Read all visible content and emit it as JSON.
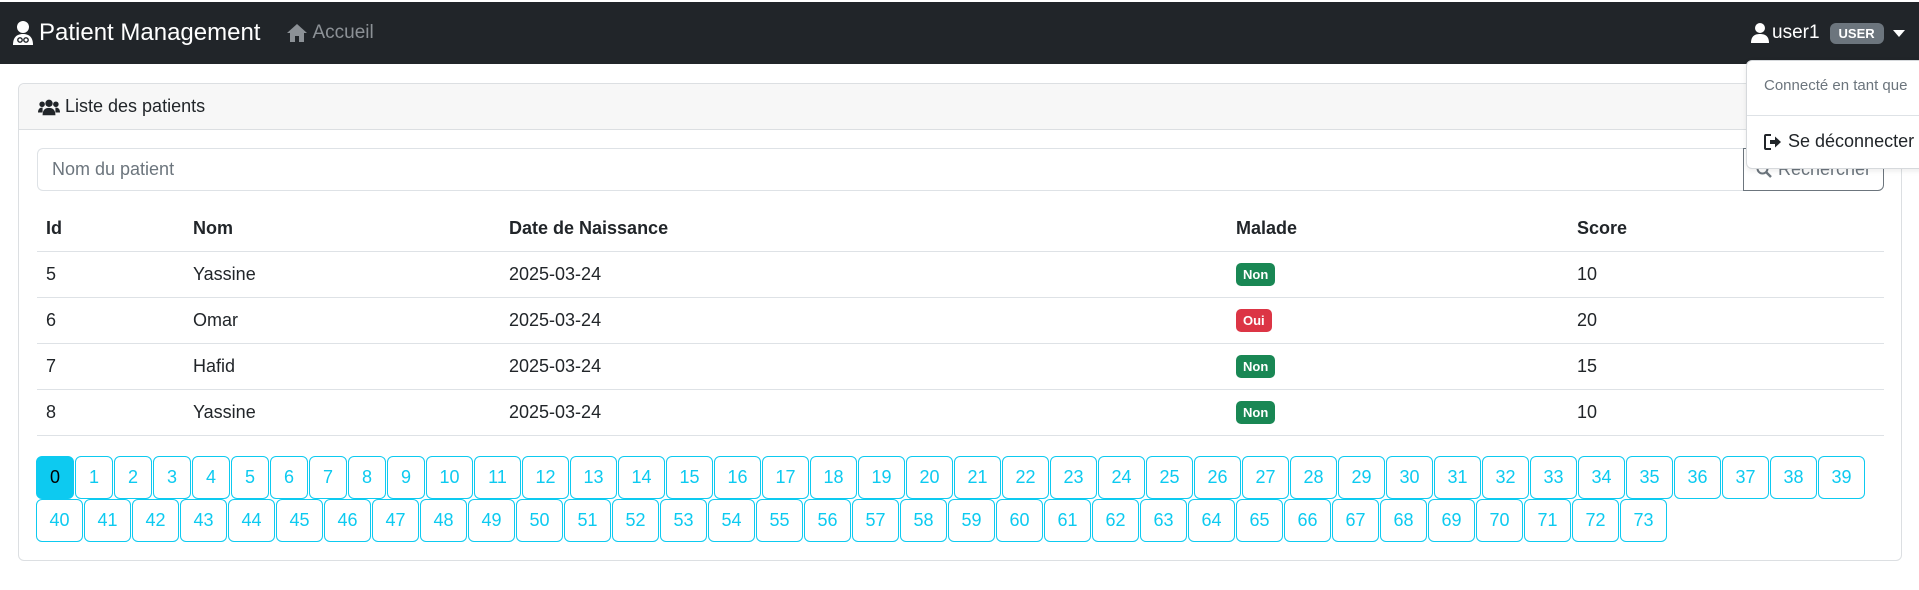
{
  "navbar": {
    "brand": "Patient Management",
    "home_link": "Accueil",
    "username": "user1",
    "role_badge": "USER",
    "bg_color": "#212529"
  },
  "user_menu": {
    "header": "Connecté en tant que",
    "logout": "Se déconnecter"
  },
  "card": {
    "title": "Liste des patients"
  },
  "search": {
    "placeholder": "Nom du patient",
    "button": "Rechercher"
  },
  "table": {
    "columns": [
      "Id",
      "Nom",
      "Date de Naissance",
      "Malade",
      "Score"
    ],
    "rows": [
      {
        "id": "5",
        "nom": "Yassine",
        "date": "2025-03-24",
        "malade": "Non",
        "score": "10"
      },
      {
        "id": "6",
        "nom": "Omar",
        "date": "2025-03-24",
        "malade": "Oui",
        "score": "20"
      },
      {
        "id": "7",
        "nom": "Hafid",
        "date": "2025-03-24",
        "malade": "Non",
        "score": "15"
      },
      {
        "id": "8",
        "nom": "Yassine",
        "date": "2025-03-24",
        "malade": "Non",
        "score": "10"
      }
    ]
  },
  "pagination": {
    "current_page": "0",
    "pages": [
      "0",
      "1",
      "2",
      "3",
      "4",
      "5",
      "6",
      "7",
      "8",
      "9",
      "10",
      "11",
      "12",
      "13",
      "14",
      "15",
      "16",
      "17",
      "18",
      "19",
      "20",
      "21",
      "22",
      "23",
      "24",
      "25",
      "26",
      "27",
      "28",
      "29",
      "30",
      "31",
      "32",
      "33",
      "34",
      "35",
      "36",
      "37",
      "38",
      "39",
      "40",
      "41",
      "42",
      "43",
      "44",
      "45",
      "46",
      "47",
      "48",
      "49",
      "50",
      "51",
      "52",
      "53",
      "54",
      "55",
      "56",
      "57",
      "58",
      "59",
      "60",
      "61",
      "62",
      "63",
      "64",
      "65",
      "66",
      "67",
      "68",
      "69",
      "70",
      "71",
      "72",
      "73"
    ]
  },
  "colors": {
    "accent_info": "#0dcaf0",
    "badge_non": "#198754",
    "badge_oui": "#dc3545",
    "role_badge": "#6c757d"
  },
  "icons": {
    "brand": "user-doctor-icon",
    "home": "home-icon",
    "user": "user-icon",
    "card": "users-icon",
    "search": "search-icon",
    "logout": "sign-out-icon"
  }
}
